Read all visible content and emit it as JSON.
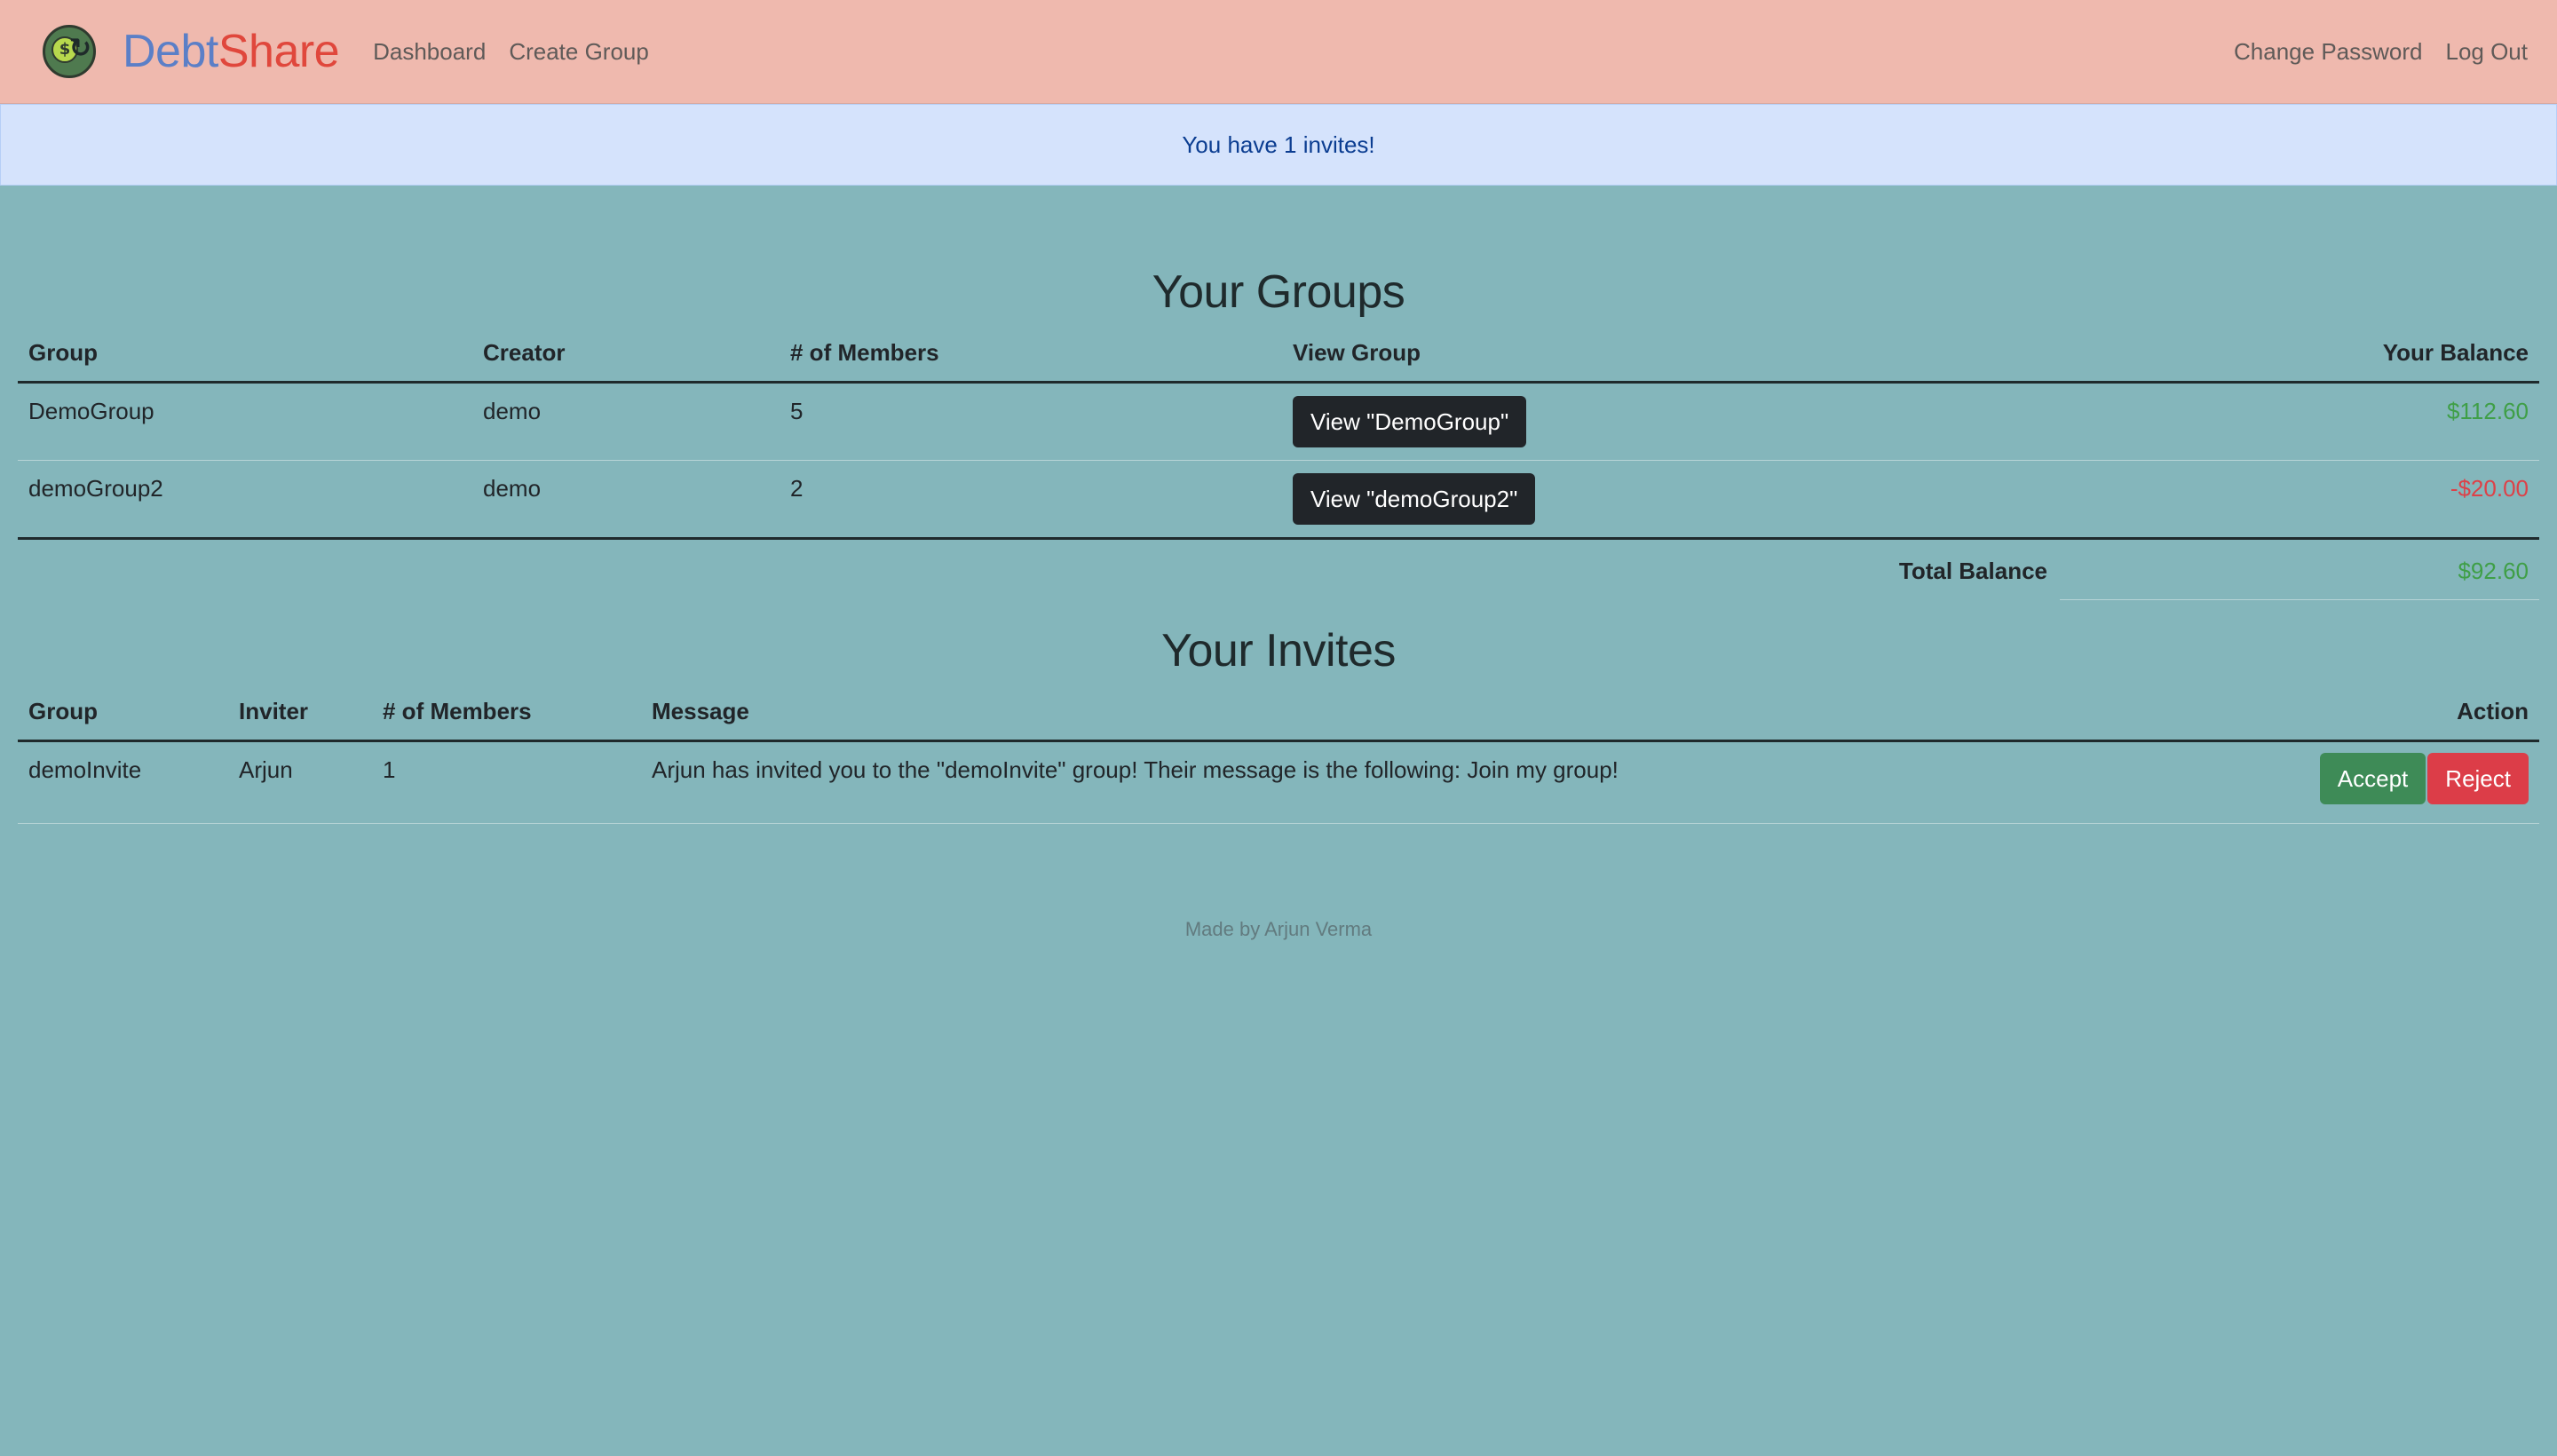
{
  "navbar": {
    "brand_part1": "Debt",
    "brand_part2": "Share",
    "logo_icon": "money-cycle-logo-icon",
    "left_links": [
      "Dashboard",
      "Create Group"
    ],
    "right_links": [
      "Change Password",
      "Log Out"
    ]
  },
  "alert": {
    "text": "You have 1 invites!"
  },
  "groups": {
    "title": "Your Groups",
    "headers": [
      "Group",
      "Creator",
      "# of Members",
      "View Group",
      "Your Balance"
    ],
    "rows": [
      {
        "group": "DemoGroup",
        "creator": "demo",
        "members": "5",
        "button": "View \"DemoGroup\"",
        "balance": "$112.60"
      },
      {
        "group": "demoGroup2",
        "creator": "demo",
        "members": "2",
        "button": "View \"demoGroup2\"",
        "balance": "-$20.00"
      }
    ],
    "total_label": "Total Balance",
    "total_value": "$92.60"
  },
  "invites": {
    "title": "Your Invites",
    "headers": [
      "Group",
      "Inviter",
      "# of Members",
      "Message",
      "Action"
    ],
    "rows": [
      {
        "group": "demoInvite",
        "inviter": "Arjun",
        "members": "1",
        "message": "Arjun has invited you to the \"demoInvite\" group! Their message is the following: Join my group!",
        "accept": "Accept",
        "reject": "Reject"
      }
    ]
  },
  "footer": {
    "text": "Made by Arjun Verma"
  },
  "colors": {
    "navbar_bg": "#efb9ae",
    "page_bg": "#84b6bb",
    "alert_bg": "#d5e3fc",
    "positive": "#3f9f47",
    "negative": "#dd4148"
  }
}
